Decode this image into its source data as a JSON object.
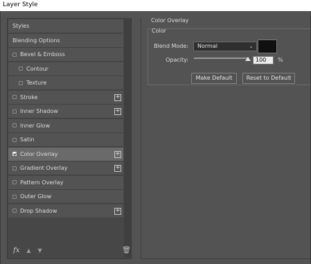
{
  "window": {
    "title": "Layer Style"
  },
  "styles_list": {
    "items": [
      {
        "label": "Styles",
        "checkbox": false,
        "checked": false,
        "plus": false,
        "indent": false,
        "selected": false
      },
      {
        "label": "Blending Options",
        "checkbox": false,
        "checked": false,
        "plus": false,
        "indent": false,
        "selected": false
      },
      {
        "label": "Bevel & Emboss",
        "checkbox": true,
        "checked": false,
        "plus": false,
        "indent": false,
        "selected": false
      },
      {
        "label": "Contour",
        "checkbox": true,
        "checked": false,
        "plus": false,
        "indent": true,
        "selected": false
      },
      {
        "label": "Texture",
        "checkbox": true,
        "checked": false,
        "plus": false,
        "indent": true,
        "selected": false
      },
      {
        "label": "Stroke",
        "checkbox": true,
        "checked": false,
        "plus": true,
        "indent": false,
        "selected": false
      },
      {
        "label": "Inner Shadow",
        "checkbox": true,
        "checked": false,
        "plus": true,
        "indent": false,
        "selected": false
      },
      {
        "label": "Inner Glow",
        "checkbox": true,
        "checked": false,
        "plus": false,
        "indent": false,
        "selected": false
      },
      {
        "label": "Satin",
        "checkbox": true,
        "checked": false,
        "plus": false,
        "indent": false,
        "selected": false
      },
      {
        "label": "Color Overlay",
        "checkbox": true,
        "checked": true,
        "plus": true,
        "indent": false,
        "selected": true
      },
      {
        "label": "Gradient Overlay",
        "checkbox": true,
        "checked": false,
        "plus": true,
        "indent": false,
        "selected": false
      },
      {
        "label": "Pattern Overlay",
        "checkbox": true,
        "checked": false,
        "plus": false,
        "indent": false,
        "selected": false
      },
      {
        "label": "Outer Glow",
        "checkbox": true,
        "checked": false,
        "plus": false,
        "indent": false,
        "selected": false
      },
      {
        "label": "Drop Shadow",
        "checkbox": true,
        "checked": false,
        "plus": true,
        "indent": false,
        "selected": false
      }
    ],
    "plus_symbol": "+",
    "footer": {
      "fx_label": "fx",
      "up_icon": "▲",
      "down_icon": "▼",
      "trash_icon": "🗑"
    }
  },
  "color_overlay": {
    "section_title": "Color Overlay",
    "group_title": "Color",
    "blend_mode_label": "Blend Mode:",
    "blend_mode_value": "Normal",
    "chevron": "⌄",
    "swatch_color": "#101010",
    "opacity_label": "Opacity:",
    "opacity_value": "100",
    "opacity_unit": "%",
    "opacity_fraction": 1.0,
    "make_default_label": "Make Default",
    "reset_default_label": "Reset to Default"
  }
}
